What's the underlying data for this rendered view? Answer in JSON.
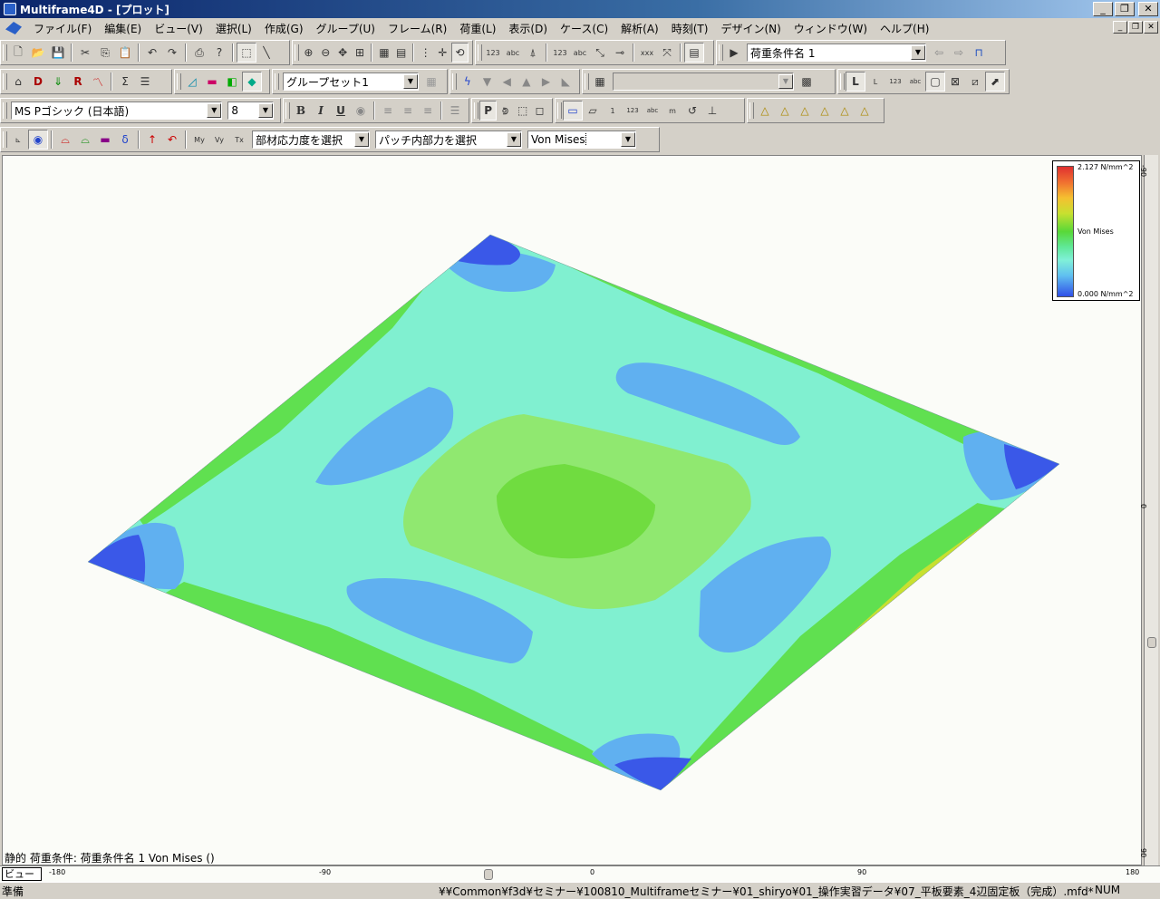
{
  "window": {
    "title": "Multiframe4D - [プロット]"
  },
  "menu": {
    "items": [
      "ファイル(F)",
      "編集(E)",
      "ビュー(V)",
      "選択(L)",
      "作成(G)",
      "グループ(U)",
      "フレーム(R)",
      "荷重(L)",
      "表示(D)",
      "ケース(C)",
      "解析(A)",
      "時刻(T)",
      "デザイン(N)",
      "ウィンドウ(W)",
      "ヘルプ(H)"
    ]
  },
  "toolbar": {
    "load_case": "荷重条件名 1",
    "group_set": "グループセット1",
    "font_name": "MS Pゴシック (日本語)",
    "font_size": "8",
    "member_stress": "部材応力度を選択",
    "patch_force": "パッチ内部力を選択",
    "plate_stress": "Von Mises"
  },
  "legend": {
    "max": "2.127 N/mm^2",
    "label": "Von Mises",
    "min": "0.000 N/mm^2"
  },
  "plot": {
    "caption": "静的 荷重条件: 荷重条件名 1  Von Mises ()",
    "view_tab": "ビュー",
    "h_ticks": [
      "-180",
      "-90",
      "0",
      "90",
      "180"
    ],
    "v_ticks": [
      "-90",
      "0",
      "90"
    ]
  },
  "status": {
    "ready": "準備",
    "path": "¥¥Common¥f3d¥セミナー¥100810_Multiframeセミナー¥01_shiryo¥01_操作実習データ¥07_平板要素_4辺固定板（完成）.mfd*",
    "num": "NUM"
  },
  "colors": {
    "base": "#80f0d0",
    "blue": "#3a58e8",
    "lightblue": "#60b0f0",
    "green": "#60e050",
    "red": "#e84050"
  }
}
